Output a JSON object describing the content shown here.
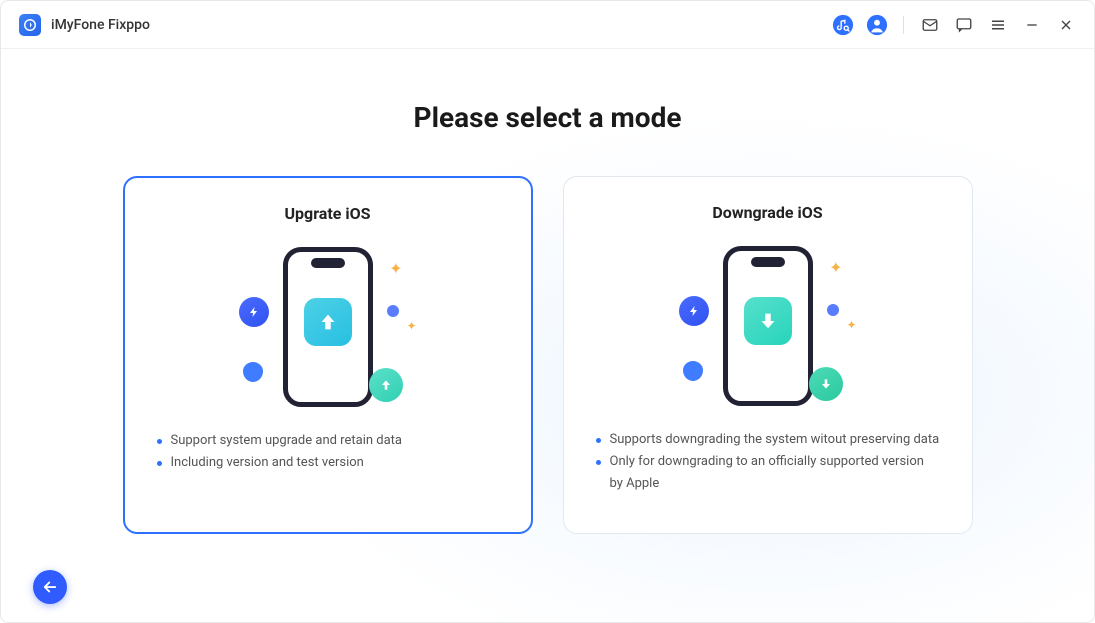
{
  "header": {
    "app_title": "iMyFone Fixppo"
  },
  "main": {
    "title": "Please select a mode",
    "cards": [
      {
        "title": "Upgrate iOS",
        "selected": true,
        "bullets": [
          "Support system upgrade and retain data",
          "Including version and test version"
        ]
      },
      {
        "title": "Downgrade iOS",
        "selected": false,
        "bullets": [
          "Supports downgrading the system witout preserving data",
          "Only for downgrading to an officially supported version by Apple"
        ]
      }
    ]
  }
}
